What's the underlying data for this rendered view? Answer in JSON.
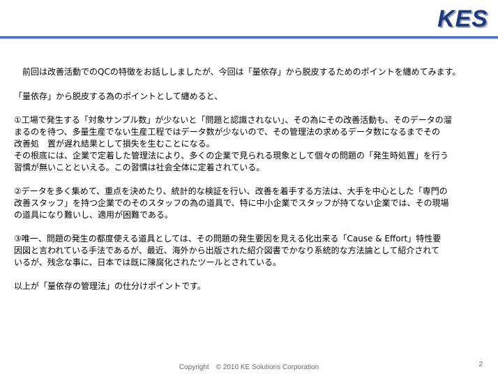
{
  "header": {
    "logo_text": "KES"
  },
  "body": {
    "intro": "前回は改善活動でのQCの特徴をお話ししましたが、今回は「量依存」から脱皮するためのポイントを纏めてみます。",
    "lead": "「量依存」から脱皮する為のポイントとして纏めると、",
    "point1": [
      "①工場で発生する「対象サンプル数」が少ないと「問題と認識されない」、その為にその改善活動も、そのデータの溜",
      "まるのを待つ、多量生産でない生産工程ではデータ数が少ないので、その管理法の求めるデータ数になるまでその",
      "改善処　置が遅れ結果として損失を生むことになる。",
      "その根底には、企業で定着した管理法により、多くの企業で見られる現象として個々の問題の「発生時処置」を行う",
      "習慣が無いことといえる。この習慣は社会全体に定着されている。"
    ],
    "point2": [
      "②データを多く集めて、重点を決めたり、統計的な検証を行い、改善を着手する方法は、大手を中心とした「専門の",
      "改善スタッフ」を持つ企業でのそのスタッフの為の道具で、特に中小企業でスタッフが持てない企業では、その現場",
      "の道具になり難いし、適用が困難である。"
    ],
    "point3": [
      "③唯一、問題の発生の都度使える道具としては、その問題の発生要因を見える化出来る「Cause & Effort」特性要",
      "因図と言われている手法であるが、最近、海外から出版された紹介図書でかなり系統的な方法論として紹介されて",
      "いるが、残念な事に、日本では既に陳腐化されたツールとされている。"
    ],
    "closing": "以上が「量依存の管理法」の仕分けポイントです。"
  },
  "footer": {
    "copyright": "Copyright　© 2010 KE Solutions Corporation",
    "page_number": "2"
  },
  "colors": {
    "logo": "#1f3a78",
    "rule": "#2f5fa8"
  }
}
